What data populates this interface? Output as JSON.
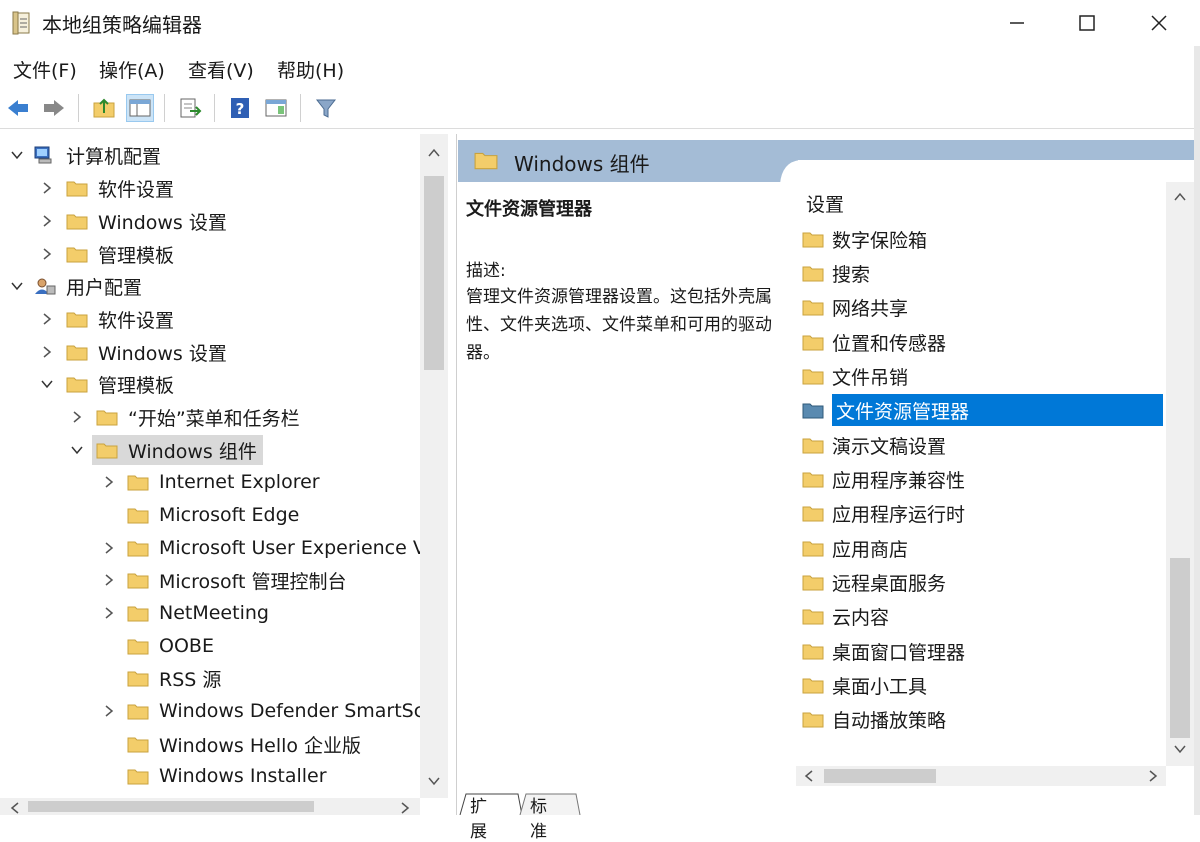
{
  "window": {
    "title": "本地组策略编辑器"
  },
  "menu": [
    "文件(F)",
    "操作(A)",
    "查看(V)",
    "帮助(H)"
  ],
  "tree": {
    "computer_config": "计算机配置",
    "cc_software": "软件设置",
    "cc_windows": "Windows 设置",
    "cc_admin": "管理模板",
    "user_config": "用户配置",
    "uc_software": "软件设置",
    "uc_windows": "Windows 设置",
    "uc_admin": "管理模板",
    "start_menu": "“开始”菜单和任务栏",
    "win_components": "Windows 组件",
    "children": [
      "Internet Explorer",
      "Microsoft Edge",
      "Microsoft User Experience V",
      "Microsoft 管理控制台",
      "NetMeeting",
      "OOBE",
      "RSS 源",
      "Windows Defender SmartSc",
      "Windows Hello 企业版",
      "Windows Installer"
    ]
  },
  "right": {
    "header": "Windows 组件",
    "desc_title": "文件资源管理器",
    "desc_label": "描述:",
    "desc_body": "管理文件资源管理器设置。这包括外壳属性、文件夹选项、文件菜单和可用的驱动器。",
    "list_header": "设置",
    "items": [
      "数字保险箱",
      "搜索",
      "网络共享",
      "位置和传感器",
      "文件吊销",
      "文件资源管理器",
      "演示文稿设置",
      "应用程序兼容性",
      "应用程序运行时",
      "应用商店",
      "远程桌面服务",
      "云内容",
      "桌面窗口管理器",
      "桌面小工具",
      "自动播放策略"
    ],
    "selected_item": "文件资源管理器",
    "tabs": [
      "扩展",
      "标准"
    ]
  },
  "colors": {
    "header_bg": "#a4bcd6",
    "selection": "#0078d7",
    "folder": "#f3cd6a"
  }
}
